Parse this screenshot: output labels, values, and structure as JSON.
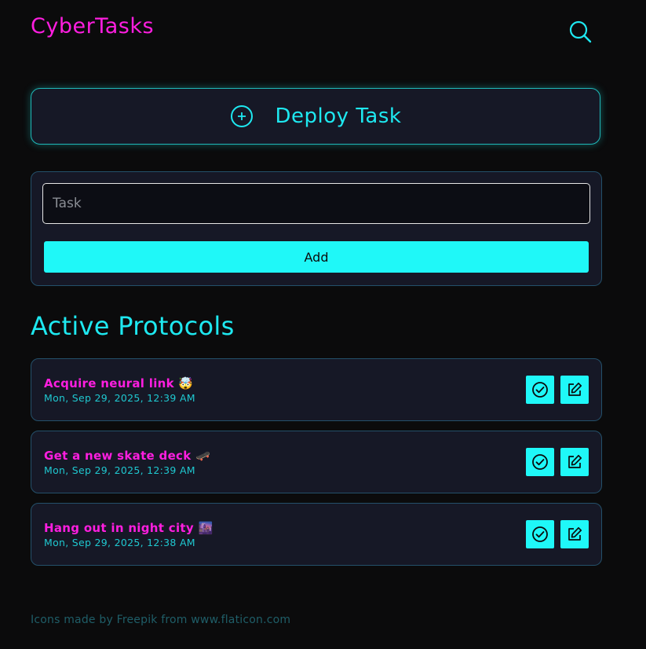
{
  "app": {
    "title": "CyberTasks"
  },
  "header": {
    "search_icon": "search-icon"
  },
  "deploy": {
    "label": "Deploy Task",
    "icon": "plus-circle-icon"
  },
  "form": {
    "placeholder": "Task",
    "value": "",
    "add_label": "Add"
  },
  "section": {
    "title": "Active Protocols"
  },
  "tasks": [
    {
      "title": "Acquire neural link 🤯",
      "time": "Mon, Sep 29, 2025, 12:39 AM"
    },
    {
      "title": "Get a new skate deck 🛹",
      "time": "Mon, Sep 29, 2025, 12:39 AM"
    },
    {
      "title": "Hang out in night city 🌆",
      "time": "Mon, Sep 29, 2025, 12:38 AM"
    }
  ],
  "footer": {
    "credit": "Icons made by Freepik from www.flaticon.com"
  },
  "colors": {
    "background": "#0b0b0c",
    "accent_cyan": "#1ff8f8",
    "accent_magenta": "#ff1ee0",
    "panel": "#161826"
  }
}
